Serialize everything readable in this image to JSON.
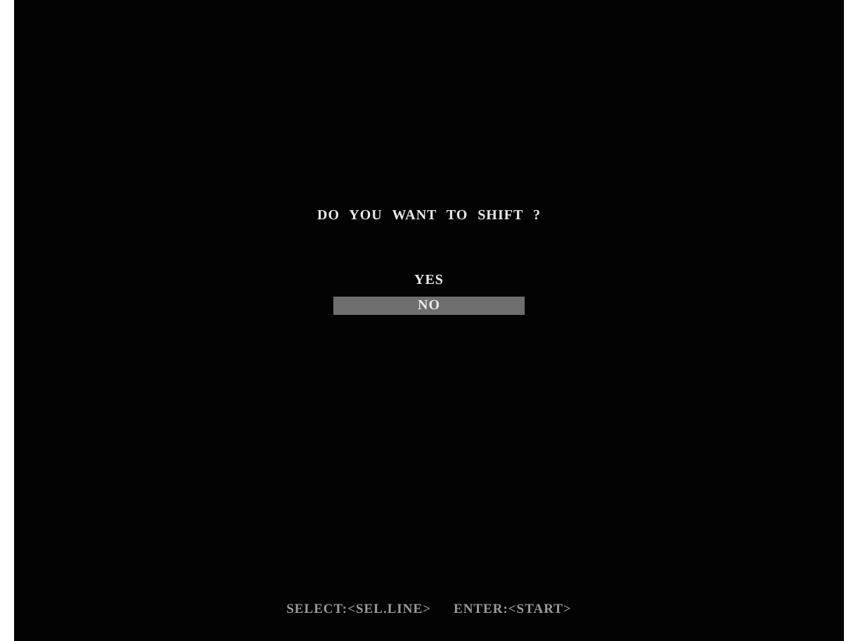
{
  "prompt": "DO YOU WANT TO SHIFT ?",
  "options": [
    {
      "label": "YES",
      "selected": false
    },
    {
      "label": "NO",
      "selected": true
    }
  ],
  "help": [
    "SELECT:<SEL.LINE>",
    "ENTER:<START>"
  ]
}
